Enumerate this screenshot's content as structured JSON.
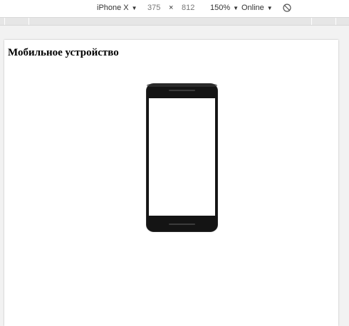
{
  "toolbar": {
    "device_label": "iPhone X",
    "width_value": "375",
    "times_sign": "×",
    "height_value": "812",
    "zoom_label": "150%",
    "network_label": "Online",
    "caret": "▼"
  },
  "page": {
    "title": "Мобильное устройство"
  },
  "colors": {
    "phone_body": "#141414",
    "screen": "#ffffff",
    "ruler": "#e6e6e6",
    "viewport_bg": "#f2f2f2"
  },
  "icons": {
    "rotate": "rotate-icon",
    "phone": "phone-icon"
  }
}
